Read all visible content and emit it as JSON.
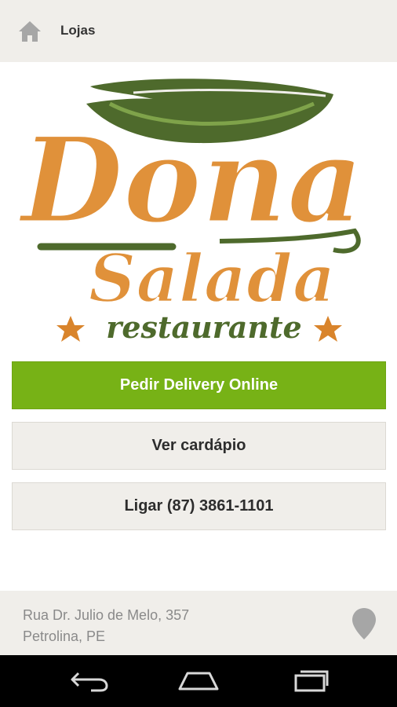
{
  "header": {
    "title": "Lojas",
    "home_icon": "home-icon"
  },
  "logo": {
    "line1": "Dona",
    "line2": "Salada",
    "line3": "restaurante",
    "colors": {
      "orange": "#e0913a",
      "green": "#4e6a2c",
      "star": "#d9842b"
    }
  },
  "actions": {
    "delivery_label": "Pedir Delivery Online",
    "menu_label": "Ver cardápio",
    "call_label": "Ligar (87) 3861-1101"
  },
  "footer": {
    "address_line1": "Rua Dr. Julio de Melo, 357",
    "address_line2": "Petrolina, PE",
    "pin_icon": "map-pin-icon"
  },
  "system_nav": {
    "back_icon": "back-icon",
    "home_icon": "home-outline-icon",
    "recents_icon": "recent-apps-icon"
  },
  "colors": {
    "accent": "#77b216",
    "surface": "#f0eeea"
  }
}
